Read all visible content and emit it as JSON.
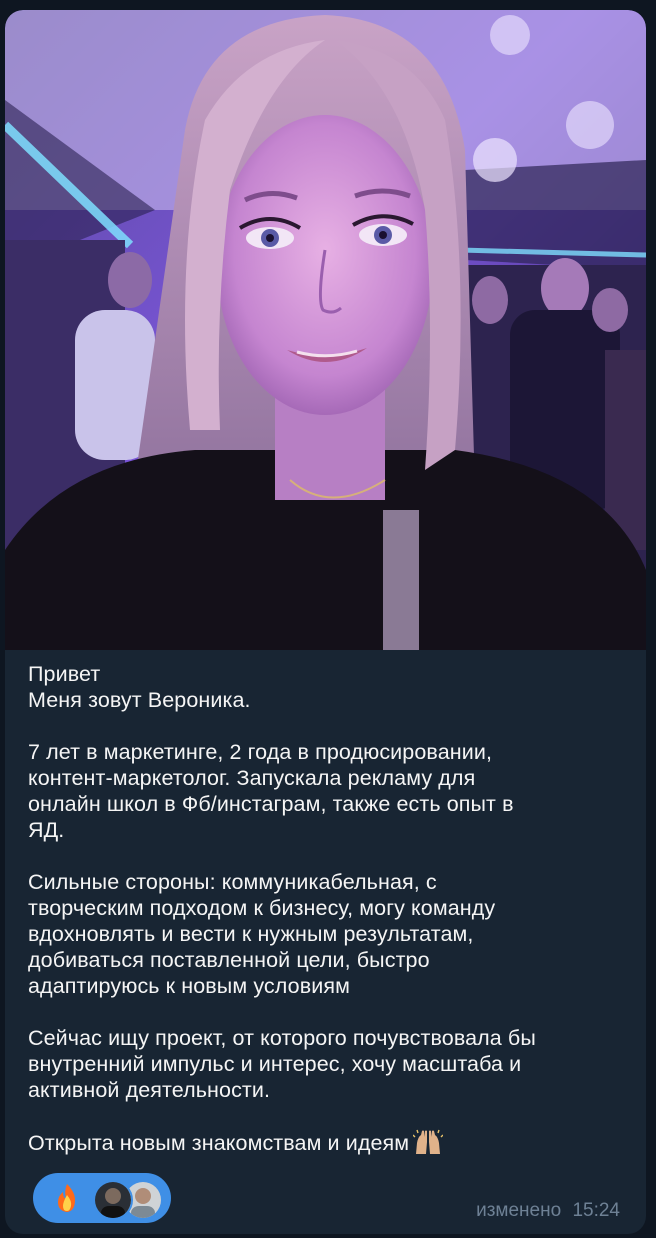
{
  "message": {
    "lines": [
      "Привет",
      "Меня зовут Вероника.",
      "",
      "7 лет в маркетинге, 2 года в продюсировании,",
      "контент-маркетолог. Запускала рекламу для",
      "онлайн школ в Фб/инстаграм, также есть опыт в",
      "ЯД.",
      "",
      "Сильные стороны: коммуникабельная, с",
      "творческим подходом к бизнесу, могу команду",
      "вдохновлять и вести к нужным результатам,",
      "добиваться поставленной цели, быстро",
      "адаптируюсь к новым условиям",
      "",
      "Сейчас ищу проект, от которого почувствовала бы",
      "внутренний импульс и интерес, хочу масштаба и",
      "активной деятельности.",
      "",
      "Открыта новым знакомствам и идеям"
    ],
    "closing_emoji": "raising-hands-icon",
    "edited_label": "изменено",
    "time": "15:24"
  },
  "reactions": {
    "emoji": "fire-icon",
    "avatars": [
      "avatar-user-1",
      "avatar-user-2"
    ],
    "accent_color": "#3f8fe6"
  },
  "colors": {
    "chat_background": "#0e1621",
    "bubble_background": "#182533",
    "text": "#f5f5f5",
    "meta_text": "#6e8195"
  }
}
